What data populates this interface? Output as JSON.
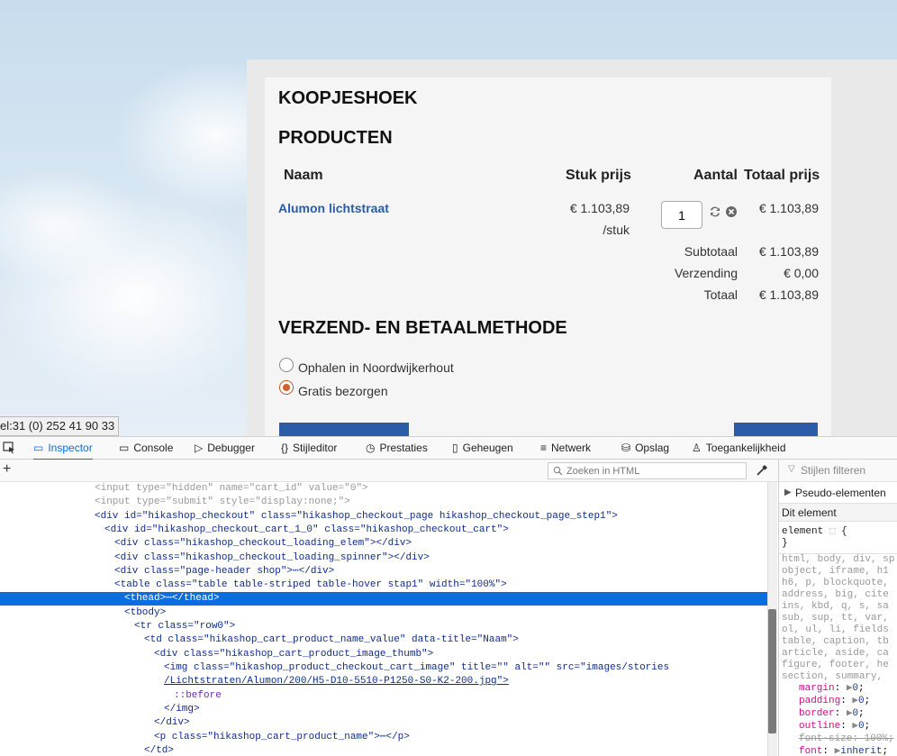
{
  "shop": {
    "section_title": "KOOPJESHOEK",
    "products_title": "PRODUCTEN",
    "columns": {
      "name": "Naam",
      "unit_price": "Stuk prijs",
      "quantity": "Aantal",
      "total": "Totaal prijs"
    },
    "product": {
      "name": "Alumon lichtstraat",
      "unit_price": "€ 1.103,89",
      "unit": "/stuk",
      "quantity": "1",
      "total": "€ 1.103,89"
    },
    "subtotal_label": "Subtotaal",
    "subtotal": "€ 1.103,89",
    "shipping_label": "Verzending",
    "shipping": "€ 0,00",
    "total_label": "Totaal",
    "total": "€ 1.103,89",
    "method_title": "VERZEND- EN BETAALMETHODE",
    "methods": [
      {
        "label": "Ophalen in Noordwijkerhout",
        "selected": false
      },
      {
        "label": "Gratis bezorgen",
        "selected": true
      }
    ],
    "accent_color": "#2a5ca8"
  },
  "tooltip": "el:31 (0) 252 41 90 33",
  "devtools": {
    "tabs": [
      {
        "label": "Inspector",
        "icon": "inspector-icon",
        "active": true
      },
      {
        "label": "Console",
        "icon": "console-icon"
      },
      {
        "label": "Debugger",
        "icon": "debugger-icon"
      },
      {
        "label": "Stijleditor",
        "icon": "style-editor-icon"
      },
      {
        "label": "Prestaties",
        "icon": "performance-icon"
      },
      {
        "label": "Geheugen",
        "icon": "memory-icon"
      },
      {
        "label": "Netwerk",
        "icon": "network-icon"
      },
      {
        "label": "Opslag",
        "icon": "storage-icon"
      },
      {
        "label": "Toegankelijkheid",
        "icon": "accessibility-icon"
      }
    ],
    "search_placeholder": "Zoeken in HTML",
    "styles_filter_placeholder": "Stijlen filteren",
    "pseudo_elements": "Pseudo-elementen",
    "this_element": "Dit element",
    "element_rule": "element",
    "element_brace_open": "{",
    "element_brace_close": "}",
    "selector_lines": [
      "html, body, div, sp",
      "object, iframe, h1",
      "h6, p, blockquote,",
      "address, big, cite",
      "ins, kbd, q, s, sa",
      "sub, sup, tt, var,",
      "ol, ul, li, fields",
      "table, caption, tb",
      "article, aside, ca",
      "figure, footer, he",
      "section, summary,"
    ],
    "props": [
      {
        "name": "margin",
        "value": "0",
        "strike": false
      },
      {
        "name": "padding",
        "value": "0",
        "strike": false
      },
      {
        "name": "border",
        "value": "0",
        "strike": false
      },
      {
        "name": "outline",
        "value": "0",
        "strike": false
      },
      {
        "name": "font-size",
        "value": "100%",
        "strike": true
      },
      {
        "name": "font",
        "value": "inherit",
        "strike": false
      }
    ],
    "html_lines": [
      "<input type=\"hidden\" name=\"cart_id\" value=\"0\">",
      "<input type=\"submit\" style=\"display:none;\">",
      "<div id=\"hikashop_checkout\" class=\"hikashop_checkout_page hikashop_checkout_page_step1\">",
      "<div id=\"hikashop_checkout_cart_1_0\" class=\"hikashop_checkout_cart\">",
      "<div class=\"hikashop_checkout_loading_elem\"></div>",
      "<div class=\"hikashop_checkout_loading_spinner\"></div>",
      "<div class=\"page-header shop\">⋯</div>",
      "<table class=\"table table-striped table-hover stap1\" width=\"100%\">",
      "<thead>⋯</thead>",
      "<tbody>",
      "<tr class=\"row0\">",
      "<td class=\"hikashop_cart_product_name_value\" data-title=\"Naam\">",
      "<div class=\"hikashop_cart_product_image_thumb\">",
      "<img class=\"hikashop_product_checkout_cart_image\" title=\"\" alt=\"\" src=\"images/stories",
      "/Lichtstraten/Alumon/200/H5-D10-5510-P1250-S0-K2-200.jpg\">",
      "::before",
      "</img>",
      "</div>",
      "<p class=\"hikashop_cart_product_name\">⋯</p>",
      "</td>"
    ]
  }
}
